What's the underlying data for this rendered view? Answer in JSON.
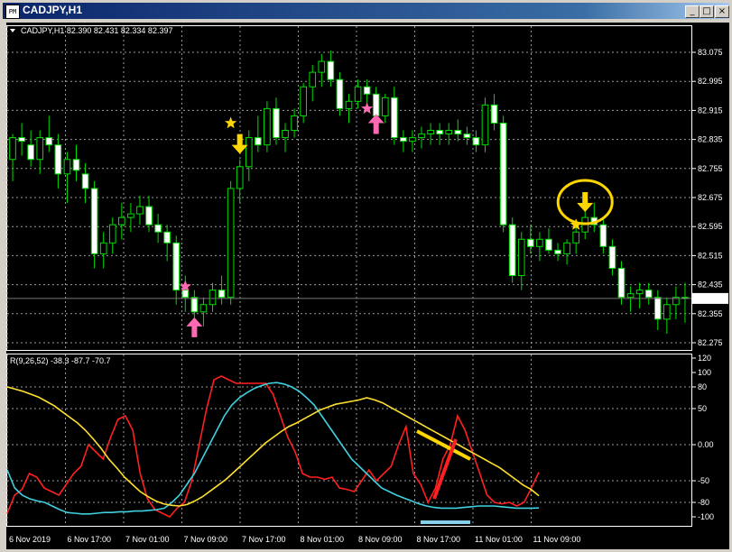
{
  "window": {
    "title": "CADJPY,H1",
    "icon_label": "PM",
    "buttons": {
      "minimize": "_",
      "maximize": "□",
      "close": "×"
    }
  },
  "chart_data": [
    {
      "type": "candlestick",
      "title": "CADJPY,H1  82.390 82.431 82.334 82.397",
      "price_axis": [
        "83.075",
        "82.995",
        "82.915",
        "82.835",
        "82.755",
        "82.675",
        "82.595",
        "82.515",
        "82.435",
        "82.355",
        "82.275"
      ],
      "current_price": "82.397",
      "ylim": [
        82.275,
        83.075
      ],
      "grid": true,
      "candles": [
        [
          82.78,
          82.85,
          82.72,
          82.84
        ],
        [
          82.84,
          82.88,
          82.79,
          82.83
        ],
        [
          82.82,
          82.86,
          82.76,
          82.78
        ],
        [
          82.78,
          82.86,
          82.74,
          82.84
        ],
        [
          82.84,
          82.9,
          82.8,
          82.82
        ],
        [
          82.82,
          82.85,
          82.7,
          82.74
        ],
        [
          82.74,
          82.8,
          82.66,
          82.78
        ],
        [
          82.78,
          82.82,
          82.72,
          82.75
        ],
        [
          82.74,
          82.77,
          82.66,
          82.7
        ],
        [
          82.7,
          82.72,
          82.48,
          82.52
        ],
        [
          82.52,
          82.58,
          82.48,
          82.55
        ],
        [
          82.55,
          82.62,
          82.52,
          82.6
        ],
        [
          82.6,
          82.66,
          82.56,
          82.62
        ],
        [
          82.62,
          82.66,
          82.58,
          82.63
        ],
        [
          82.63,
          82.68,
          82.6,
          82.65
        ],
        [
          82.65,
          82.68,
          82.58,
          82.6
        ],
        [
          82.6,
          82.63,
          82.55,
          82.58
        ],
        [
          82.58,
          82.6,
          82.5,
          82.55
        ],
        [
          82.55,
          82.57,
          82.38,
          82.42
        ],
        [
          82.42,
          82.46,
          82.36,
          82.4
        ],
        [
          82.4,
          82.42,
          82.33,
          82.36
        ],
        [
          82.36,
          82.4,
          82.32,
          82.38
        ],
        [
          82.38,
          82.44,
          82.36,
          82.42
        ],
        [
          82.42,
          82.46,
          82.38,
          82.4
        ],
        [
          82.4,
          82.72,
          82.38,
          82.7
        ],
        [
          82.7,
          82.78,
          82.66,
          82.76
        ],
        [
          82.76,
          82.86,
          82.72,
          82.84
        ],
        [
          82.84,
          82.9,
          82.8,
          82.82
        ],
        [
          82.82,
          82.94,
          82.8,
          82.92
        ],
        [
          82.92,
          82.95,
          82.82,
          82.84
        ],
        [
          82.84,
          82.88,
          82.8,
          82.86
        ],
        [
          82.86,
          82.92,
          82.84,
          82.9
        ],
        [
          82.9,
          82.99,
          82.88,
          82.98
        ],
        [
          82.98,
          83.04,
          82.94,
          83.02
        ],
        [
          83.02,
          83.07,
          82.98,
          83.05
        ],
        [
          83.05,
          83.08,
          82.98,
          83.0
        ],
        [
          83.0,
          83.02,
          82.9,
          82.92
        ],
        [
          82.92,
          82.96,
          82.88,
          82.94
        ],
        [
          82.94,
          83.0,
          82.92,
          82.98
        ],
        [
          82.98,
          83.0,
          82.92,
          82.96
        ],
        [
          82.96,
          82.98,
          82.88,
          82.9
        ],
        [
          82.9,
          82.96,
          82.88,
          82.95
        ],
        [
          82.95,
          82.98,
          82.82,
          82.84
        ],
        [
          82.84,
          82.86,
          82.8,
          82.83
        ],
        [
          82.83,
          82.86,
          82.8,
          82.84
        ],
        [
          82.84,
          82.87,
          82.81,
          82.85
        ],
        [
          82.85,
          82.88,
          82.82,
          82.86
        ],
        [
          82.86,
          82.88,
          82.82,
          82.85
        ],
        [
          82.85,
          82.88,
          82.82,
          82.86
        ],
        [
          82.86,
          82.89,
          82.83,
          82.85
        ],
        [
          82.85,
          82.87,
          82.82,
          82.84
        ],
        [
          82.84,
          82.86,
          82.8,
          82.82
        ],
        [
          82.82,
          82.95,
          82.8,
          82.93
        ],
        [
          82.93,
          82.96,
          82.86,
          82.88
        ],
        [
          82.88,
          82.9,
          82.58,
          82.6
        ],
        [
          82.6,
          82.62,
          82.44,
          82.46
        ],
        [
          82.46,
          82.58,
          82.42,
          82.56
        ],
        [
          82.56,
          82.6,
          82.52,
          82.54
        ],
        [
          82.54,
          82.58,
          82.5,
          82.56
        ],
        [
          82.56,
          82.59,
          82.52,
          82.53
        ],
        [
          82.53,
          82.55,
          82.5,
          82.52
        ],
        [
          82.52,
          82.56,
          82.49,
          82.55
        ],
        [
          82.55,
          82.6,
          82.52,
          82.58
        ],
        [
          82.58,
          82.64,
          82.56,
          82.62
        ],
        [
          82.62,
          82.66,
          82.58,
          82.6
        ],
        [
          82.6,
          82.62,
          82.52,
          82.54
        ],
        [
          82.54,
          82.56,
          82.46,
          82.48
        ],
        [
          82.48,
          82.5,
          82.38,
          82.4
        ],
        [
          82.4,
          82.43,
          82.36,
          82.41
        ],
        [
          82.41,
          82.44,
          82.37,
          82.42
        ],
        [
          82.42,
          82.44,
          82.38,
          82.4
        ],
        [
          82.4,
          82.42,
          82.31,
          82.34
        ],
        [
          82.34,
          82.4,
          82.3,
          82.38
        ],
        [
          82.38,
          82.43,
          82.34,
          82.4
        ],
        [
          82.4,
          82.44,
          82.33,
          82.397
        ]
      ],
      "markers": [
        {
          "type": "star",
          "color": "#ffd700",
          "index": 24,
          "price": 82.88
        },
        {
          "type": "arrow-down",
          "color": "#ffd700",
          "index": 25,
          "price": 82.82
        },
        {
          "type": "star",
          "color": "#ff69b4",
          "index": 19,
          "price": 82.43
        },
        {
          "type": "arrow-up",
          "color": "#ff69b4",
          "index": 20,
          "price": 82.32
        },
        {
          "type": "star",
          "color": "#ff69b4",
          "index": 39,
          "price": 82.92
        },
        {
          "type": "arrow-up",
          "color": "#ff69b4",
          "index": 40,
          "price": 82.88
        },
        {
          "type": "star",
          "color": "#ffd700",
          "index": 62,
          "price": 82.6
        },
        {
          "type": "arrow-down",
          "color": "#ffd700",
          "index": 63,
          "price": 82.66
        }
      ],
      "circle": {
        "color": "#ffd700",
        "index": 63,
        "price": 82.66
      }
    },
    {
      "type": "line",
      "title": "R(9,26,52) -38.3 -87.7 -70.7",
      "y_axis": [
        "120",
        "100",
        "80",
        "50",
        "0.00",
        "-50",
        "-80",
        "-100"
      ],
      "ylim": [
        -105,
        120
      ],
      "x_ticks": [
        "6 Nov 2019",
        "6 Nov 17:00",
        "7 Nov 01:00",
        "7 Nov 09:00",
        "7 Nov 17:00",
        "8 Nov 01:00",
        "8 Nov 09:00",
        "8 Nov 17:00",
        "11 Nov 01:00",
        "11 Nov 09:00"
      ],
      "series": [
        {
          "color": "#ff2020",
          "values": [
            -95,
            -70,
            -62,
            -40,
            -45,
            -60,
            -65,
            -70,
            -55,
            -40,
            -30,
            0,
            -10,
            -20,
            10,
            35,
            40,
            20,
            -40,
            -75,
            -90,
            -95,
            -100,
            -88,
            -80,
            -50,
            0,
            50,
            90,
            95,
            90,
            85,
            85,
            85,
            85,
            85,
            70,
            40,
            10,
            -10,
            -40,
            -45,
            -45,
            -48,
            -45,
            -60,
            -62,
            -65,
            -50,
            -35,
            -50,
            -40,
            -30,
            0,
            25,
            -40,
            -55,
            -80,
            -60,
            -20,
            0,
            40,
            20,
            -10,
            -40,
            -70,
            -80,
            -82,
            -80,
            -85,
            -80,
            -60,
            -38.3
          ]
        },
        {
          "color": "#40d0e0",
          "values": [
            -35,
            -60,
            -70,
            -75,
            -78,
            -80,
            -85,
            -90,
            -94,
            -95,
            -96,
            -96,
            -95,
            -94,
            -94,
            -93,
            -93,
            -92,
            -92,
            -91,
            -90,
            -88,
            -80,
            -70,
            -55,
            -40,
            -20,
            0,
            20,
            40,
            55,
            65,
            72,
            78,
            82,
            85,
            86,
            84,
            80,
            74,
            65,
            55,
            40,
            25,
            10,
            -5,
            -20,
            -30,
            -40,
            -50,
            -60,
            -65,
            -70,
            -74,
            -78,
            -82,
            -85,
            -87,
            -88,
            -88,
            -88,
            -87,
            -86,
            -85,
            -85,
            -85,
            -86,
            -87,
            -88,
            -88,
            -88,
            -87.7
          ]
        },
        {
          "color": "#ffe030",
          "values": [
            80,
            77,
            74,
            70,
            66,
            60,
            54,
            46,
            38,
            30,
            20,
            8,
            -5,
            -20,
            -32,
            -45,
            -55,
            -65,
            -72,
            -78,
            -82,
            -84,
            -85,
            -83,
            -78,
            -72,
            -64,
            -56,
            -48,
            -38,
            -28,
            -18,
            -8,
            2,
            10,
            18,
            25,
            30,
            36,
            42,
            48,
            52,
            56,
            58,
            60,
            62,
            65,
            62,
            58,
            52,
            46,
            40,
            34,
            28,
            22,
            16,
            10,
            4,
            -2,
            -8,
            -14,
            -20,
            -26,
            -32,
            -40,
            -48,
            -56,
            -62,
            -70.7
          ]
        }
      ],
      "marks": [
        {
          "type": "yellow-slash",
          "color": "#ffd700"
        },
        {
          "type": "red-slash",
          "color": "#ff2020"
        },
        {
          "type": "cyan-bar",
          "color": "#87ceeb"
        }
      ]
    }
  ]
}
